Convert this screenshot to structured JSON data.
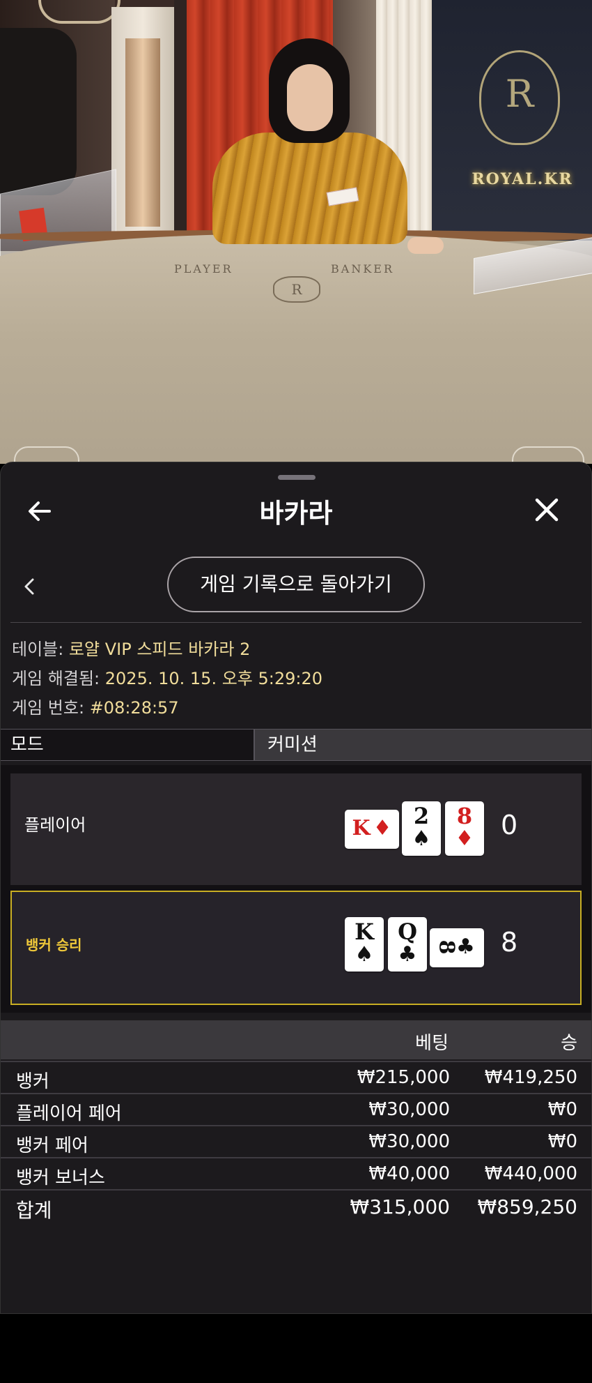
{
  "video": {
    "table_labels": [
      "PLAYER",
      "BANKER"
    ],
    "brand": "ROYAL.KR",
    "crest_letter": "R"
  },
  "header": {
    "title": "바카라",
    "back_icon": "arrow-left-icon",
    "close_icon": "close-icon"
  },
  "nav": {
    "history_button": "게임 기록으로 돌아가기"
  },
  "info": {
    "table_label": "테이블:",
    "table_value": "로얄 VIP 스피드 바카라 2",
    "resolved_label": "게임 해결됨:",
    "resolved_value": "2025. 10. 15. 오후 5:29:20",
    "game_no_label": "게임 번호:",
    "game_no_value": "#08:28:57"
  },
  "mode": {
    "mode_label": "모드",
    "commission_label": "커미션"
  },
  "hands": {
    "player": {
      "label": "플레이어",
      "score": "0",
      "cards": [
        {
          "rank": "K",
          "suit": "♦",
          "color": "red",
          "orientation": "horizontal"
        },
        {
          "rank": "2",
          "suit": "♠",
          "color": "black",
          "orientation": "vertical"
        },
        {
          "rank": "8",
          "suit": "♦",
          "color": "red",
          "orientation": "vertical"
        }
      ]
    },
    "banker": {
      "label": "뱅커 승리",
      "score": "8",
      "cards": [
        {
          "rank": "K",
          "suit": "♠",
          "color": "black",
          "orientation": "vertical"
        },
        {
          "rank": "Q",
          "suit": "♣",
          "color": "black",
          "orientation": "vertical"
        },
        {
          "rank": "8",
          "suit": "♣",
          "color": "black",
          "orientation": "horizontal"
        }
      ]
    },
    "highlight_color": "#c9ae23"
  },
  "bets": {
    "col_bet": "베팅",
    "col_win": "승",
    "rows": [
      {
        "name": "뱅커",
        "bet": "₩215,000",
        "win": "₩419,250"
      },
      {
        "name": "플레이어 페어",
        "bet": "₩30,000",
        "win": "₩0"
      },
      {
        "name": "뱅커 페어",
        "bet": "₩30,000",
        "win": "₩0"
      },
      {
        "name": "뱅커 보너스",
        "bet": "₩40,000",
        "win": "₩440,000"
      }
    ],
    "total": {
      "name": "합계",
      "bet": "₩315,000",
      "win": "₩859,250"
    }
  }
}
